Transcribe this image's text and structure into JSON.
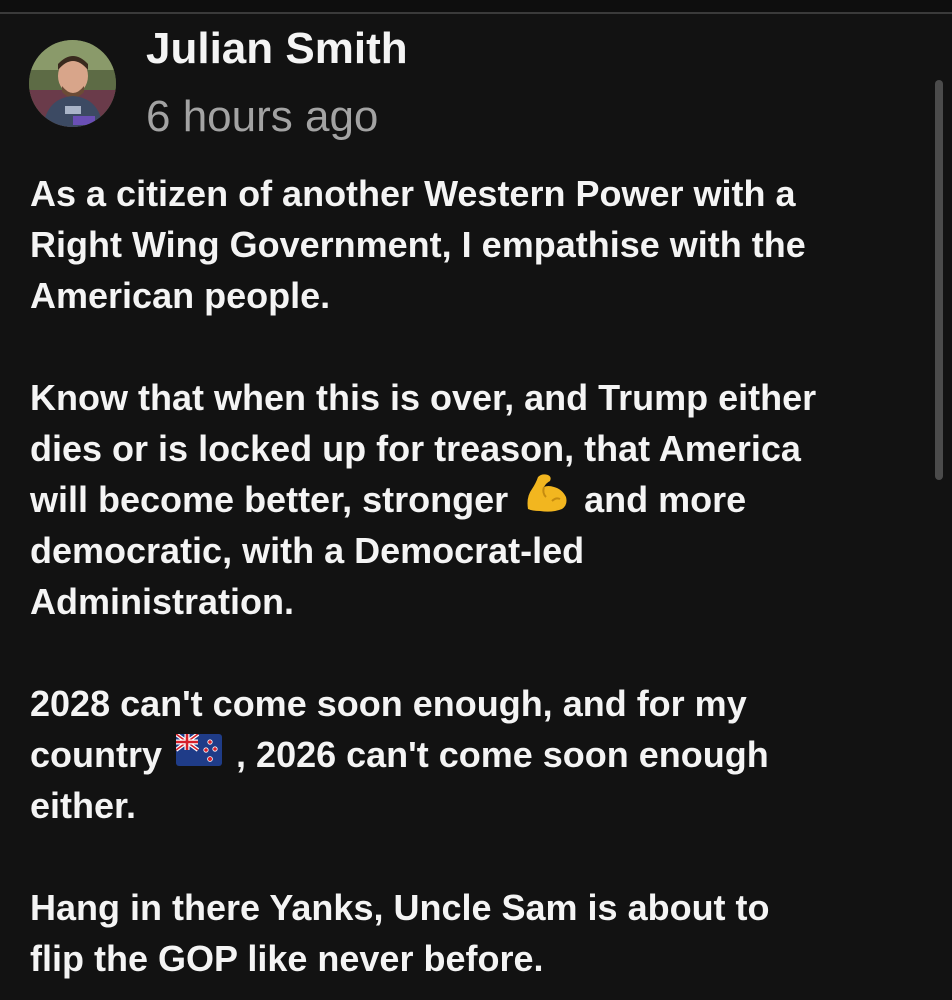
{
  "post": {
    "author": "Julian Smith",
    "timestamp": "6 hours ago",
    "paragraphs": [
      {
        "lines": [
          "As a citizen of another Western Power with a",
          "Right Wing Government, I empathise with the",
          "American people."
        ]
      },
      {
        "lines": [
          "Know that when this is over, and Trump either",
          "dies or is locked up for treason, that America"
        ],
        "line3_before": "will become better, stronger",
        "line3_emoji": "flexed-biceps-icon",
        "line3_after": "and more",
        "lines_after": [
          "democratic, with a Democrat-led",
          "Administration."
        ]
      },
      {
        "line1": "2028 can't come soon enough, and for my",
        "line2_before": "country",
        "line2_emoji": "new-zealand-flag-icon",
        "line2_after": ", 2026 can't come soon enough",
        "line3": "either."
      },
      {
        "lines": [
          "Hang in there Yanks, Uncle Sam is about to",
          "flip the GOP like never before."
        ]
      }
    ]
  },
  "colors": {
    "background": "#121212",
    "text": "#f4f4f4",
    "secondary_text": "#a3a3a3",
    "scrollbar": "#4b4b4b"
  }
}
